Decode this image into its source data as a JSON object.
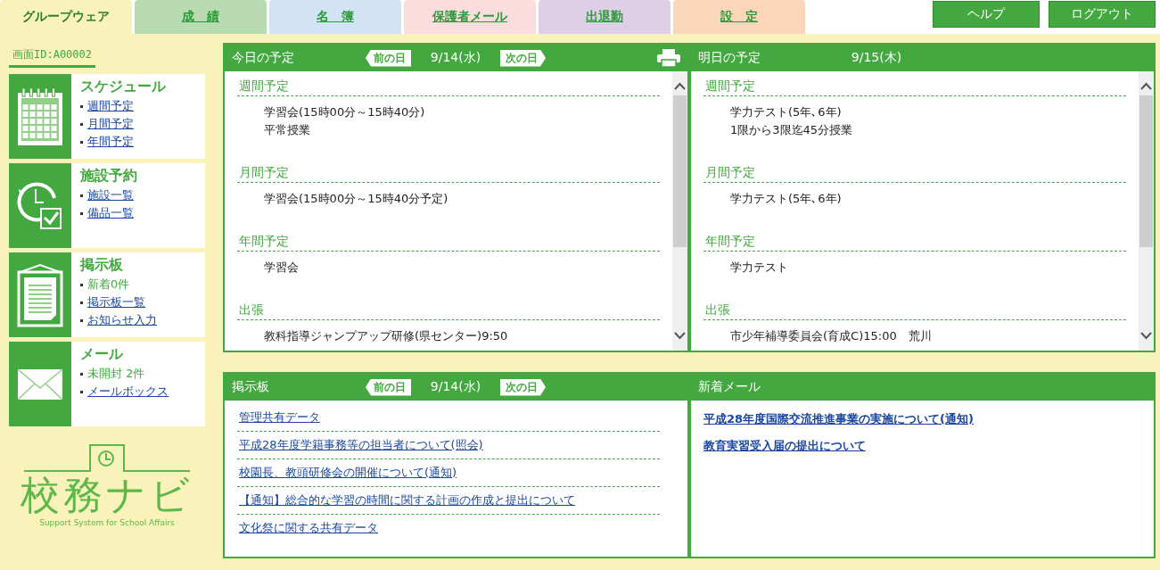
{
  "tabs": [
    {
      "label": "グループウェア",
      "selected": true,
      "color": "#faf2bb"
    },
    {
      "label": "成　績",
      "selected": false,
      "color": "#b8dbb1"
    },
    {
      "label": "名　簿",
      "selected": false,
      "color": "#d3e3f6"
    },
    {
      "label": "保護者メール",
      "selected": false,
      "color": "#fbdddd"
    },
    {
      "label": "出退勤",
      "selected": false,
      "color": "#dccfe6"
    },
    {
      "label": "設　定",
      "selected": false,
      "color": "#fcd6bb"
    }
  ],
  "header_buttons": [
    "ヘルプ",
    "ログアウト"
  ],
  "screen_id": "画面ID:A00002",
  "sidebar": {
    "items": [
      {
        "title": "スケジュール",
        "entries": [
          {
            "kind": "link",
            "text": "週間予定"
          },
          {
            "kind": "link",
            "text": "月間予定"
          },
          {
            "kind": "link",
            "text": "年間予定"
          }
        ]
      },
      {
        "title": "施設予約",
        "entries": [
          {
            "kind": "link",
            "text": "施設一覧"
          },
          {
            "kind": "link",
            "text": "備品一覧"
          }
        ]
      },
      {
        "title": "掲示板",
        "entries": [
          {
            "kind": "text",
            "text": "新着0件"
          },
          {
            "kind": "link",
            "text": "掲示板一覧"
          },
          {
            "kind": "link",
            "text": "お知らせ入力"
          }
        ]
      },
      {
        "title": "メール",
        "entries": [
          {
            "kind": "text",
            "text": "未開封 2件"
          },
          {
            "kind": "link",
            "text": "メールボックス"
          }
        ]
      }
    ]
  },
  "logo": {
    "title": "校務ナビ",
    "subtitle": "Support System for School Affairs"
  },
  "schedule_panels": [
    {
      "title": "今日の予定",
      "prev": "前の日",
      "date": "9/14(水)",
      "next": "次の日",
      "printable": true,
      "sections": [
        {
          "heading": "週間予定",
          "lines": [
            "学習会(15時00分～15時40分)",
            "平常授業"
          ]
        },
        {
          "heading": "月間予定",
          "lines": [
            "学習会(15時00分～15時40分予定)"
          ]
        },
        {
          "heading": "年間予定",
          "lines": [
            "学習会"
          ]
        },
        {
          "heading": "出張",
          "lines": [
            "教科指導ジャンプアップ研修(県センター)9:50"
          ]
        }
      ]
    },
    {
      "title": "明日の予定",
      "date": "9/15(木)",
      "printable": false,
      "sections": [
        {
          "heading": "週間予定",
          "lines": [
            "学力テスト(5年､6年)",
            "1限から3限迄45分授業"
          ]
        },
        {
          "heading": "月間予定",
          "lines": [
            "学力テスト(5年､6年)"
          ]
        },
        {
          "heading": "年間予定",
          "lines": [
            "学力テスト"
          ]
        },
        {
          "heading": "出張",
          "lines": [
            "市少年補導委員会(育成C)15:00　荒川"
          ]
        }
      ]
    }
  ],
  "bulletin": {
    "title": "掲示板",
    "prev": "前の日",
    "date": "9/14(水)",
    "next": "次の日",
    "links": [
      "管理共有データ",
      "平成28年度学籍事務等の担当者について(照会)",
      "校園長、教頭研修会の開催について(通知)",
      "【通知】総合的な学習の時間に関する計画の作成と提出について",
      "文化祭に関する共有データ"
    ]
  },
  "new_mail": {
    "title": "新着メール",
    "links": [
      "平成28年度国際交流推進事業の実施について(通知)",
      "教育実習受入届の提出について"
    ]
  }
}
